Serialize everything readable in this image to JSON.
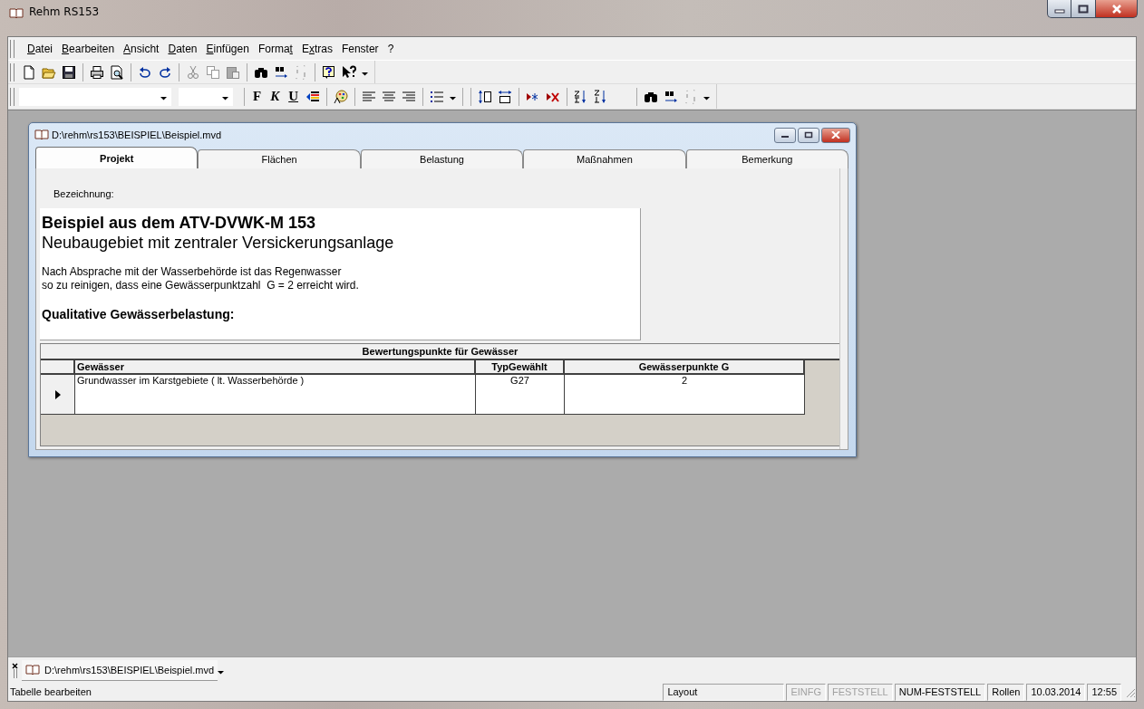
{
  "window": {
    "title": "Rehm RS153"
  },
  "menu": [
    {
      "accel": "D",
      "tail": "atei"
    },
    {
      "accel": "B",
      "tail": "earbeiten"
    },
    {
      "accel": "A",
      "tail": "nsicht"
    },
    {
      "accel": "D",
      "tail": "aten"
    },
    {
      "accel": "E",
      "tail": "infügen"
    },
    {
      "lead": "Forma",
      "accel": "t"
    },
    {
      "lead": "E",
      "accel": "x",
      "tail": "tras"
    },
    {
      "lead": "Fenster"
    },
    {
      "lead": "?"
    }
  ],
  "format_buttons": [
    {
      "label": "F",
      "kind": "bold"
    },
    {
      "label": "K",
      "kind": "italic"
    },
    {
      "label": "U",
      "kind": "underline"
    }
  ],
  "document": {
    "title": "D:\\rehm\\rs153\\BEISPIEL\\Beispiel.mvd",
    "tabs": [
      {
        "label": "Projekt",
        "selected": true
      },
      {
        "label": "Flächen",
        "selected": false
      },
      {
        "label": "Belastung",
        "selected": false
      },
      {
        "label": "Maßnahmen",
        "selected": false
      },
      {
        "label": "Bemerkung",
        "selected": false
      }
    ],
    "field_label": "Bezeichnung:",
    "description": [
      {
        "kind": "heading",
        "text": "Beispiel aus dem ATV-DVWK-M 153"
      },
      {
        "kind": "highlight",
        "text": "Neubaugebiet mit zentraler Versickerungsanlage"
      },
      {
        "kind": "body",
        "text": "Nach Absprache mit der Wasserbehörde ist das Regenwasser"
      },
      {
        "kind": "body_end",
        "text": "so zu reinigen, dass eine Gewässerpunktzahl  G = 2 erreicht wird."
      },
      {
        "kind": "label",
        "text": "Qualitative Gewässerbelastung:"
      }
    ],
    "grid": {
      "caption": "Bewertungspunkte für Gewässer",
      "columns": [
        "Gewässer",
        "TypGewählt",
        "Gewässerpunkte G"
      ],
      "rows": [
        {
          "selected": true,
          "cells": [
            "Grundwasser im Karstgebiete ( lt. Wasserbehörde )",
            "G27",
            "2"
          ]
        }
      ]
    }
  },
  "open_documents": [
    {
      "title": "D:\\rehm\\rs153\\BEISPIEL\\Beispiel.mvd"
    }
  ],
  "status_bar": {
    "message": "Tabelle bearbeiten",
    "panels": [
      {
        "text": "Layout",
        "disabled": false
      },
      {
        "text": "EINFG",
        "disabled": true
      },
      {
        "text": "FESTSTELL",
        "disabled": true
      },
      {
        "text": "NUM-FESTSTELL",
        "disabled": false
      },
      {
        "text": "Rollen",
        "disabled": false
      },
      {
        "text": "10.03.2014",
        "disabled": false
      },
      {
        "text": "12:55",
        "disabled": false
      }
    ]
  }
}
